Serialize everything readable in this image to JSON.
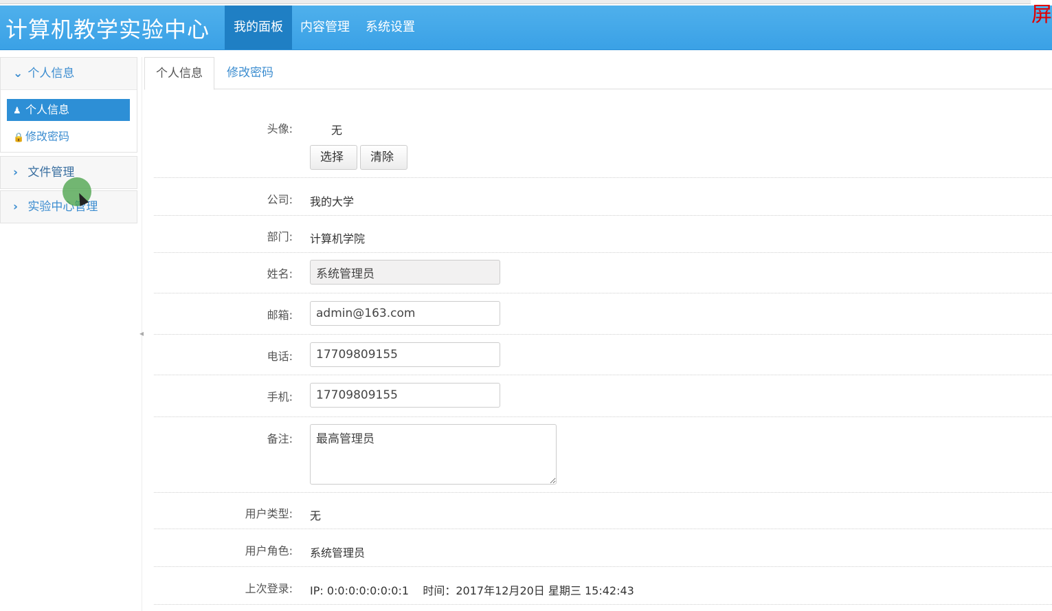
{
  "brand": "计算机教学实验中心",
  "corner_mark": "屏",
  "nav": {
    "items": [
      {
        "label": "我的面板",
        "active": true
      },
      {
        "label": "内容管理",
        "active": false
      },
      {
        "label": "系统设置",
        "active": false
      }
    ]
  },
  "sidebar": {
    "groups": [
      {
        "title": "个人信息",
        "expanded": true,
        "items": [
          {
            "label": "个人信息",
            "icon": "user-icon",
            "active": true
          },
          {
            "label": "修改密码",
            "icon": "lock-icon",
            "active": false
          }
        ]
      },
      {
        "title": "文件管理",
        "expanded": false
      },
      {
        "title": "实验中心管理",
        "expanded": false
      }
    ]
  },
  "tabs": [
    {
      "label": "个人信息",
      "active": true
    },
    {
      "label": "修改密码",
      "active": false
    }
  ],
  "form": {
    "avatar_label": "头像:",
    "avatar_value": "无",
    "select_button": "选择",
    "clear_button": "清除",
    "company_label": "公司:",
    "company_value": "我的大学",
    "department_label": "部门:",
    "department_value": "计算机学院",
    "name_label": "姓名:",
    "name_value": "系统管理员",
    "email_label": "邮箱:",
    "email_value": "admin@163.com",
    "phone_label": "电话:",
    "phone_value": "17709809155",
    "mobile_label": "手机:",
    "mobile_value": "17709809155",
    "remark_label": "备注:",
    "remark_value": "最高管理员",
    "user_type_label": "用户类型:",
    "user_type_value": "无",
    "user_role_label": "用户角色:",
    "user_role_value": "系统管理员",
    "last_login_label": "上次登录:",
    "last_login_value": "IP: 0:0:0:0:0:0:0:1    时间：2017年12月20日 星期三 15:42:43"
  },
  "colors": {
    "navbar": "#3aa1e6",
    "nav_active": "#1f7fc4",
    "link": "#3c8dd0",
    "sidebar_active": "#2d8fd6"
  }
}
